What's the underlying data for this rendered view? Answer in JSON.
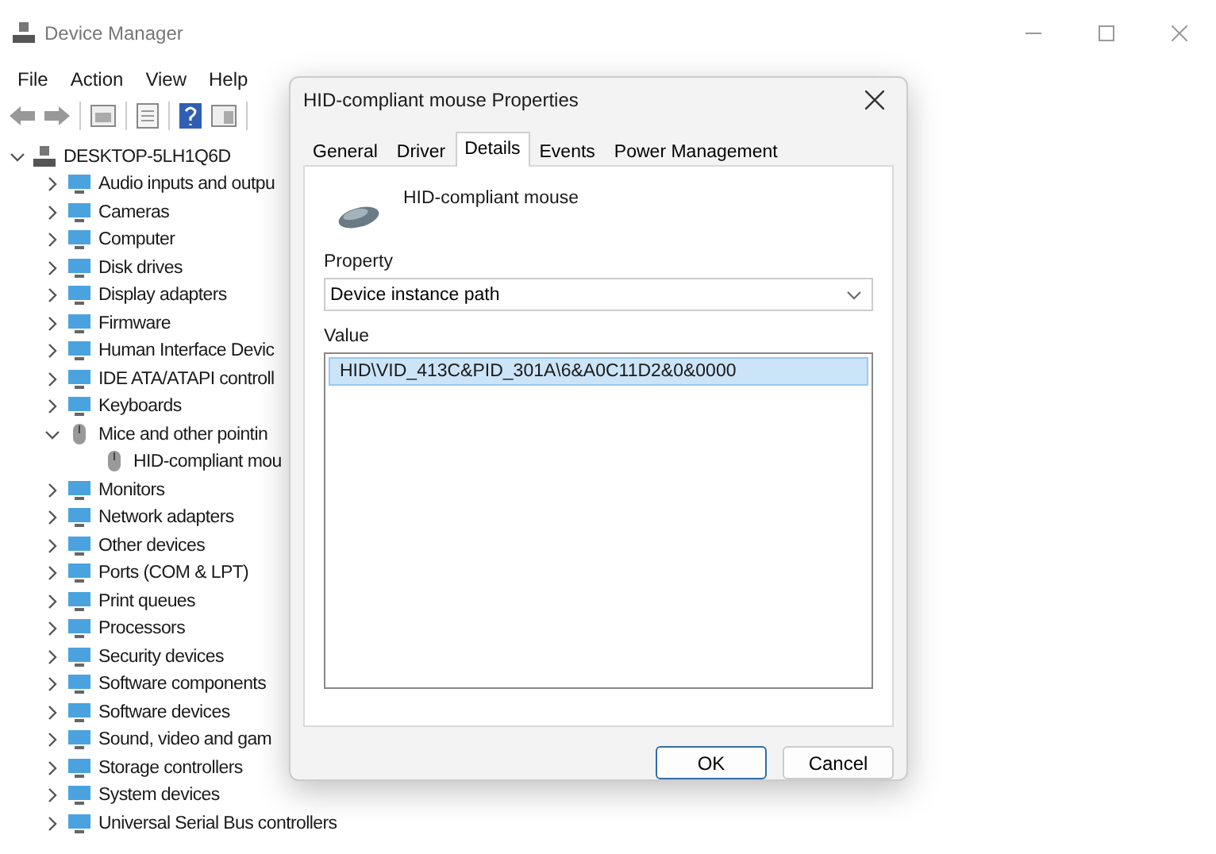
{
  "window": {
    "title": "Device Manager"
  },
  "menu": [
    "File",
    "Action",
    "View",
    "Help"
  ],
  "tree": {
    "label": "DESKTOP-5LH1Q6D",
    "expanded": true,
    "children": [
      {
        "label": "Audio inputs and outpu",
        "expanded": false
      },
      {
        "label": "Cameras",
        "expanded": false
      },
      {
        "label": "Computer",
        "expanded": false
      },
      {
        "label": "Disk drives",
        "expanded": false
      },
      {
        "label": "Display adapters",
        "expanded": false
      },
      {
        "label": "Firmware",
        "expanded": false
      },
      {
        "label": "Human Interface Devic",
        "expanded": false
      },
      {
        "label": "IDE ATA/ATAPI controll",
        "expanded": false
      },
      {
        "label": "Keyboards",
        "expanded": false
      },
      {
        "label": "Mice and other pointin",
        "expanded": true,
        "children": [
          {
            "label": "HID-compliant mou"
          }
        ]
      },
      {
        "label": "Monitors",
        "expanded": false
      },
      {
        "label": "Network adapters",
        "expanded": false
      },
      {
        "label": "Other devices",
        "expanded": false
      },
      {
        "label": "Ports (COM & LPT)",
        "expanded": false
      },
      {
        "label": "Print queues",
        "expanded": false
      },
      {
        "label": "Processors",
        "expanded": false
      },
      {
        "label": "Security devices",
        "expanded": false
      },
      {
        "label": "Software components",
        "expanded": false
      },
      {
        "label": "Software devices",
        "expanded": false
      },
      {
        "label": "Sound, video and gam",
        "expanded": false
      },
      {
        "label": "Storage controllers",
        "expanded": false
      },
      {
        "label": "System devices",
        "expanded": false
      },
      {
        "label": "Universal Serial Bus controllers",
        "expanded": false
      }
    ]
  },
  "dialog": {
    "title": "HID-compliant mouse Properties",
    "tabs": [
      {
        "label": "General",
        "selected": false
      },
      {
        "label": "Driver",
        "selected": false
      },
      {
        "label": "Details",
        "selected": true
      },
      {
        "label": "Events",
        "selected": false
      },
      {
        "label": "Power Management",
        "selected": false
      }
    ],
    "device_name": "HID-compliant mouse",
    "property_label": "Property",
    "property_value": "Device instance path",
    "value_label": "Value",
    "values": [
      {
        "text": "HID\\VID_413C&PID_301A\\6&A0C11D2&0&0000",
        "selected": true
      }
    ],
    "buttons": [
      "OK",
      "Cancel"
    ]
  }
}
